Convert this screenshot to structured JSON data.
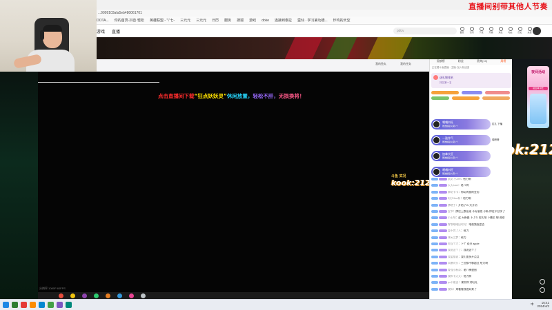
{
  "overlay": {
    "title": "直播间别带其他人节奏"
  },
  "browser": {
    "url": "...9999103afa5eb480061701",
    "bookmarks": [
      "DOTA...",
      "你的首页·抖音·轻松",
      "英雄联盟 - \"\\\"七-",
      "三元元",
      "三元元",
      "日历",
      "服务",
      "搜狐",
      "游戏",
      "doke",
      "连接到泰拉",
      "歪仙 · 学习第功德...",
      "炸鸡的天空"
    ]
  },
  "site": {
    "nav": [
      "游戏",
      "直播"
    ],
    "search_placeholder": "pdcv",
    "nav_icons": [
      "首页",
      "订阅",
      "下载",
      "开播",
      "消息",
      "动态",
      "历史",
      "充值"
    ]
  },
  "player": {
    "marquee_segments": [
      {
        "text": "点击直播间下载",
        "color": "#ff2d2d"
      },
      {
        "text": "“狂点妖妖灵”",
        "color": "#ffe100"
      },
      {
        "text": "休闲放置，",
        "color": "#27d8ff"
      },
      {
        "text": "轻松不肝，",
        "color": "#9b6bff"
      },
      {
        "text": "无损换将！",
        "color": "#ff5a8a"
      }
    ],
    "status": "分辨率 1080P 60FPS",
    "header_buttons": [
      "我的鱼丸",
      "我的任务"
    ]
  },
  "watermark": {
    "main": "kook:212",
    "sub": "斗鱼  实况"
  },
  "watermark_large": {
    "main": "kook:212",
    "sub": "熊猫直播"
  },
  "chat": {
    "tabs": [
      "贡献榜",
      "粉丝",
      "贵宾(10)",
      "周榜"
    ],
    "active_tab": 3,
    "sub": "正在看斗鱼直播 · 主播: 加入粉丝团",
    "gift_title": "送礼物排名",
    "gift_subtitle": "排名第一名",
    "gift_cards": [
      {
        "name": "噶嘎刘旺",
        "desc": "赠送超级火箭1个",
        "extra": "拉扎 下播"
      },
      {
        "name": "一鼓作气",
        "desc": "赠送超级火箭1个",
        "extra": "噶吧嗒"
      },
      {
        "name": "加拿大狂",
        "desc": "赠送超级火箭1个",
        "extra": ""
      },
      {
        "name": "噶嘎刘旺",
        "desc": "赠送超级火箭1个",
        "extra": ""
      }
    ],
    "messages": [
      {
        "user": "凯文 小Jeff",
        "text": "：给力啊"
      },
      {
        "user": "天天tuan",
        "text": "：老八咧"
      },
      {
        "user": "牌坊卡卡",
        "text": "：你玩的我的金药"
      },
      {
        "user": "阿沙Jiao有",
        "text": "：给力啊"
      },
      {
        "user": "拂晓丁",
        "text": "：开始了么 大开药"
      },
      {
        "user": "宝书",
        "text": "：牌位上都出现 不好意思 小新 你在平台学了"
      },
      {
        "user": "小土吧",
        "text": "：这 天新疆 下了么 拉扎吧 下播主 想 说刚"
      },
      {
        "user": "零零暗暗旧时光",
        "text": "：电视频段是否"
      },
      {
        "user": "暂不完了人",
        "text": "：给力"
      },
      {
        "user": "休闲之梦",
        "text": "：给力"
      },
      {
        "user": "你当个才",
        "text": "：下个 双分 apple"
      },
      {
        "user": "我说这个了",
        "text": "：我说这个了"
      },
      {
        "user": "我爱猫说",
        "text": "：我们血多开点点"
      },
      {
        "user": "风暴对头",
        "text": "：三位都不够超过 给力啊"
      },
      {
        "user": "骨强小新奇",
        "text": "：老八神速图"
      },
      {
        "user": "我和卡天天",
        "text": "：给力啊"
      },
      {
        "user": "pz不能去",
        "text": "：来抓你 刘旺旺"
      },
      {
        "user": "我知",
        "text": "：来看看我爸妈来了"
      }
    ]
  },
  "gadget": {
    "title": "夜间活动",
    "button": "拔给神 鲜芝"
  },
  "taskbar": {
    "time": "16:41",
    "date": "2024/4/2",
    "tray_items": [
      "中",
      "英"
    ],
    "icon_colors": [
      "#1e88e5",
      "#2e7d32",
      "#e53935",
      "#fb8c00",
      "#0288d1",
      "#43a047",
      "#7e57c2",
      "#00897b"
    ]
  }
}
